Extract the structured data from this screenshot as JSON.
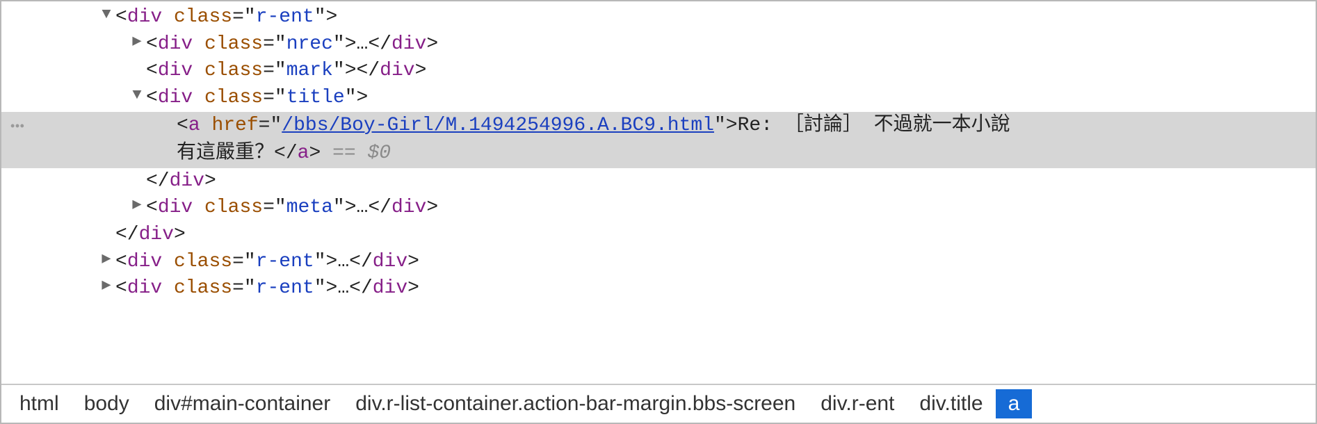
{
  "code": {
    "tag_div": "div",
    "tag_a": "a",
    "attr_class": "class",
    "attr_href": "href",
    "class_r_ent": "r-ent",
    "class_nrec": "nrec",
    "class_mark": "mark",
    "class_title": "title",
    "class_meta": "meta",
    "href_value": "/bbs/Boy-Girl/M.1494254996.A.BC9.html",
    "link_text": "Re: ［討論］ 不過就一本小說 有這嚴重？",
    "link_text_line1": "Re: ［討論］ 不過就一本小說 ",
    "link_text_line2": "有這嚴重？",
    "ellipsis": "…",
    "eq0": "$0",
    "eq_sign": "==",
    "gutter_dots": "•••"
  },
  "breadcrumb": [
    "html",
    "body",
    "div#main-container",
    "div.r-list-container.action-bar-margin.bbs-screen",
    "div.r-ent",
    "div.title",
    "a"
  ]
}
